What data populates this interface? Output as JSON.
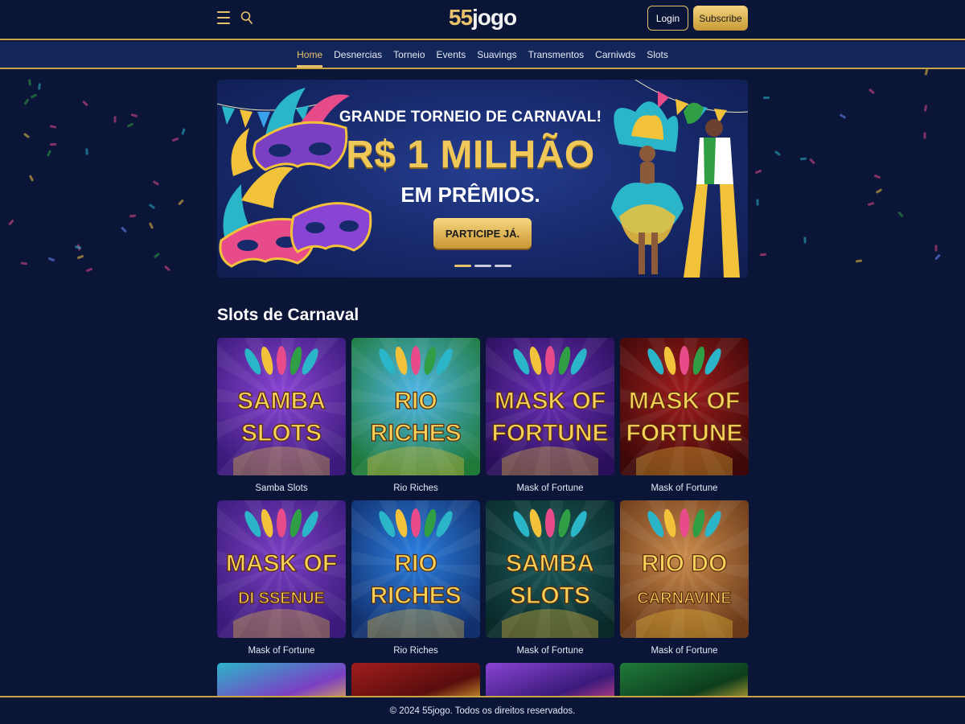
{
  "header": {
    "logo_number": "55",
    "logo_text": "jogo",
    "login_label": "Login",
    "subscribe_label": "Subscribe"
  },
  "nav": {
    "items": [
      {
        "label": "Home",
        "active": true
      },
      {
        "label": "Desnercias",
        "active": false
      },
      {
        "label": "Torneio",
        "active": false
      },
      {
        "label": "Events",
        "active": false
      },
      {
        "label": "Suavings",
        "active": false
      },
      {
        "label": "Transmentos",
        "active": false
      },
      {
        "label": "Carniwds",
        "active": false
      },
      {
        "label": "Slots",
        "active": false
      }
    ]
  },
  "hero": {
    "title": "GRANDE TORNEIO DE CARNAVAL!",
    "prize": "R$ 1 MILHÃO",
    "subtitle": "EM PRÊMIOS.",
    "cta_label": "PARTICIPE JÁ.",
    "slides": 3,
    "active_slide": 1
  },
  "section": {
    "title": "Slots de Carnaval"
  },
  "games": [
    {
      "label": "Samba Slots",
      "art_line1": "SAMBA",
      "art_line2": "SLOTS"
    },
    {
      "label": "Rio Riches",
      "art_line1": "RIO",
      "art_line2": "RICHES"
    },
    {
      "label": "Mask of Fortune",
      "art_line1": "MASK OF",
      "art_line2": "FORTUNE"
    },
    {
      "label": "Mask of Fortune",
      "art_line1": "MASK OF",
      "art_line2": "FORTUNE"
    },
    {
      "label": "Mask of Fortune",
      "art_line1": "MASK OF",
      "art_line2": "DI SSENUE"
    },
    {
      "label": "Rio Riches",
      "art_line1": "RIO",
      "art_line2": "RICHES"
    },
    {
      "label": "Mask of Fortune",
      "art_line1": "SAMBA",
      "art_line2": "SLOTS"
    },
    {
      "label": "Mask of Fortune",
      "art_line1": "RIO DO",
      "art_line2": "CARNAVINE"
    }
  ],
  "colors": {
    "background": "#0b1538",
    "accent_gold": "#e7c26b",
    "nav_bg": "#13265a"
  },
  "footer": {
    "text": "© 2024 55jogo. Todos os direitos reservados."
  }
}
